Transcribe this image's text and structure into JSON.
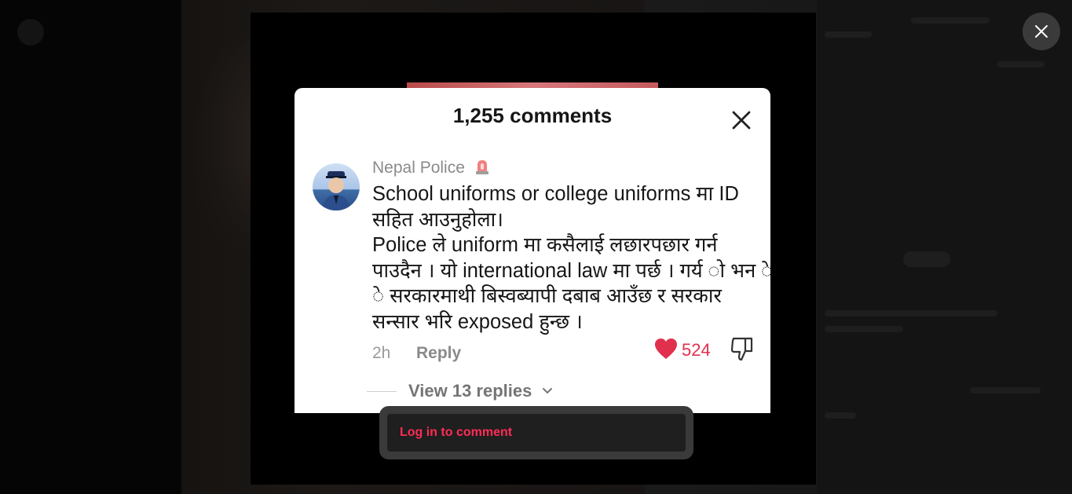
{
  "modal": {
    "close_label": "close",
    "close_icon": "x-close-icon"
  },
  "video_frame": {
    "title": "1,255 comments",
    "comment": {
      "author": "Nepal Police",
      "author_emoji": "siren-icon",
      "lines": [
        "School uniforms or college uniforms मा ID सहित आउनुहोला।",
        "Police ले uniform मा कसैलाई लछारपछार गर्न पाउदैन । यो international law मा पर्छ । गर्य ो भन े सरकारमाथी बिस्वब्यापी दबाब आउँछ र सरकार सन्सार भरि exposed हुन्छ ।"
      ],
      "time": "2h",
      "reply_label": "Reply",
      "likes": "524",
      "view_replies": "View 13 replies"
    }
  },
  "login": {
    "label": "Log in to comment"
  },
  "colors": {
    "accent": "#fe2c55",
    "like": "#e0304e"
  }
}
